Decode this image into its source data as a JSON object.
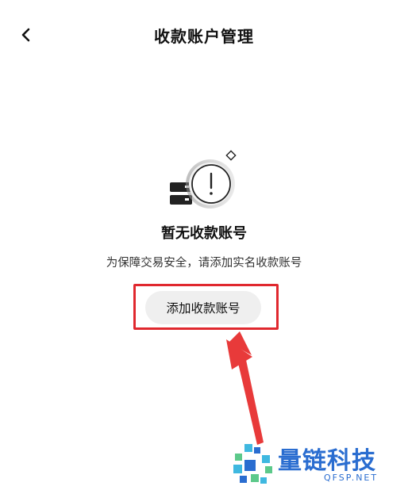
{
  "header": {
    "title": "收款账户管理",
    "back_icon": "chevron-left-icon"
  },
  "empty_state": {
    "illustration": "server-warning-illustration",
    "title": "暂无收款账号",
    "description": "为保障交易安全，请添加实名收款账号"
  },
  "actions": {
    "add_button_label": "添加收款账号"
  },
  "annotation": {
    "highlight_color": "#e0282e",
    "arrow_color": "#e83a3a"
  },
  "watermark": {
    "name": "量链科技",
    "url": "QFSP.NET",
    "color": "#2a6dd0",
    "logo_colors": [
      "#2a6dd0",
      "#3fb8e0",
      "#5cc98a"
    ]
  }
}
